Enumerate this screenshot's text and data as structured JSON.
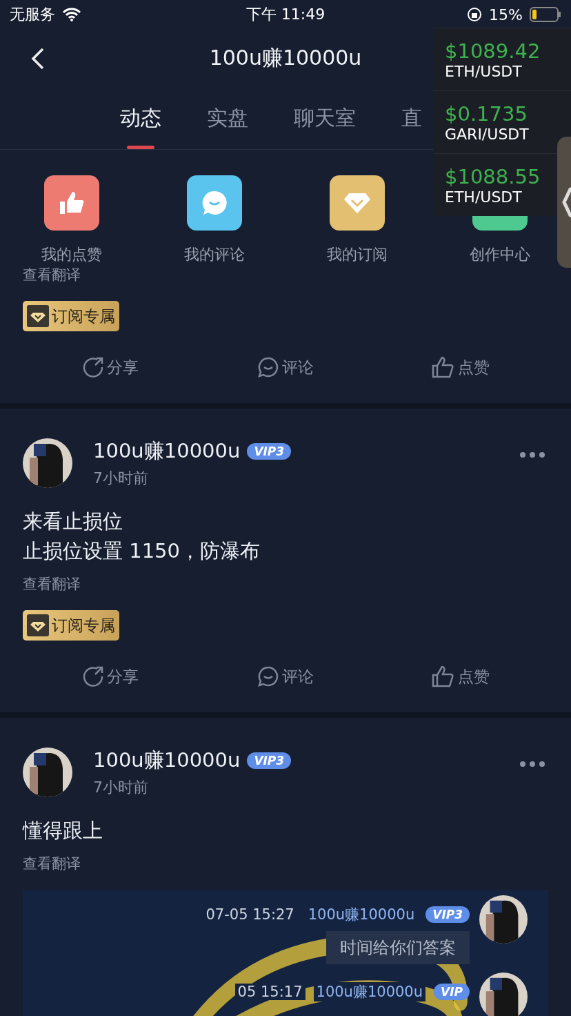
{
  "status_bar": {
    "carrier": "无服务",
    "time": "下午 11:49",
    "battery": "15%"
  },
  "nav": {
    "title": "100u赚10000u"
  },
  "tabs": [
    {
      "label": "动态",
      "selected": true
    },
    {
      "label": "实盘",
      "selected": false
    },
    {
      "label": "聊天室",
      "selected": false
    },
    {
      "label": "直",
      "selected": false
    }
  ],
  "tickers": [
    {
      "price": "$1089.42",
      "pair": "ETH/USDT"
    },
    {
      "price": "$0.1735",
      "pair": "GARI/USDT"
    },
    {
      "price": "$1088.55",
      "pair": "ETH/USDT"
    }
  ],
  "shortcuts": [
    {
      "kind": "like",
      "label": "我的点赞",
      "color": "#ee7b72"
    },
    {
      "kind": "comment",
      "label": "我的评论",
      "color": "#5bc4ee"
    },
    {
      "kind": "subscribe",
      "label": "我的订阅",
      "color": "#e3bf72"
    },
    {
      "kind": "create",
      "label": "创作中心",
      "color": "#4ec98f"
    }
  ],
  "posts": [
    {
      "translate": "查看翻译",
      "badge": "订阅专属",
      "actions": [
        {
          "kind": "share",
          "label": "分享"
        },
        {
          "kind": "comment",
          "label": "评论"
        },
        {
          "kind": "like",
          "label": "点赞"
        }
      ]
    },
    {
      "author": "100u赚10000u",
      "vip": "VIP3",
      "time": "7小时前",
      "lines": [
        "来看止损位",
        "止损位设置 1150，防瀑布"
      ],
      "translate": "查看翻译",
      "badge": "订阅专属",
      "actions": [
        {
          "kind": "share",
          "label": "分享"
        },
        {
          "kind": "comment",
          "label": "评论"
        },
        {
          "kind": "like",
          "label": "点赞"
        }
      ]
    },
    {
      "author": "100u赚10000u",
      "vip": "VIP3",
      "time": "7小时前",
      "lines": [
        "懂得跟上"
      ],
      "translate": "查看翻译",
      "image": {
        "messages": [
          {
            "time": "07-05 15:27",
            "name": "100u赚10000u",
            "vip": "VIP3",
            "text": "时间给你们答案"
          },
          {
            "time": "05 15:17",
            "name": "100u赚10000u",
            "vip": "VIP"
          }
        ]
      }
    }
  ]
}
